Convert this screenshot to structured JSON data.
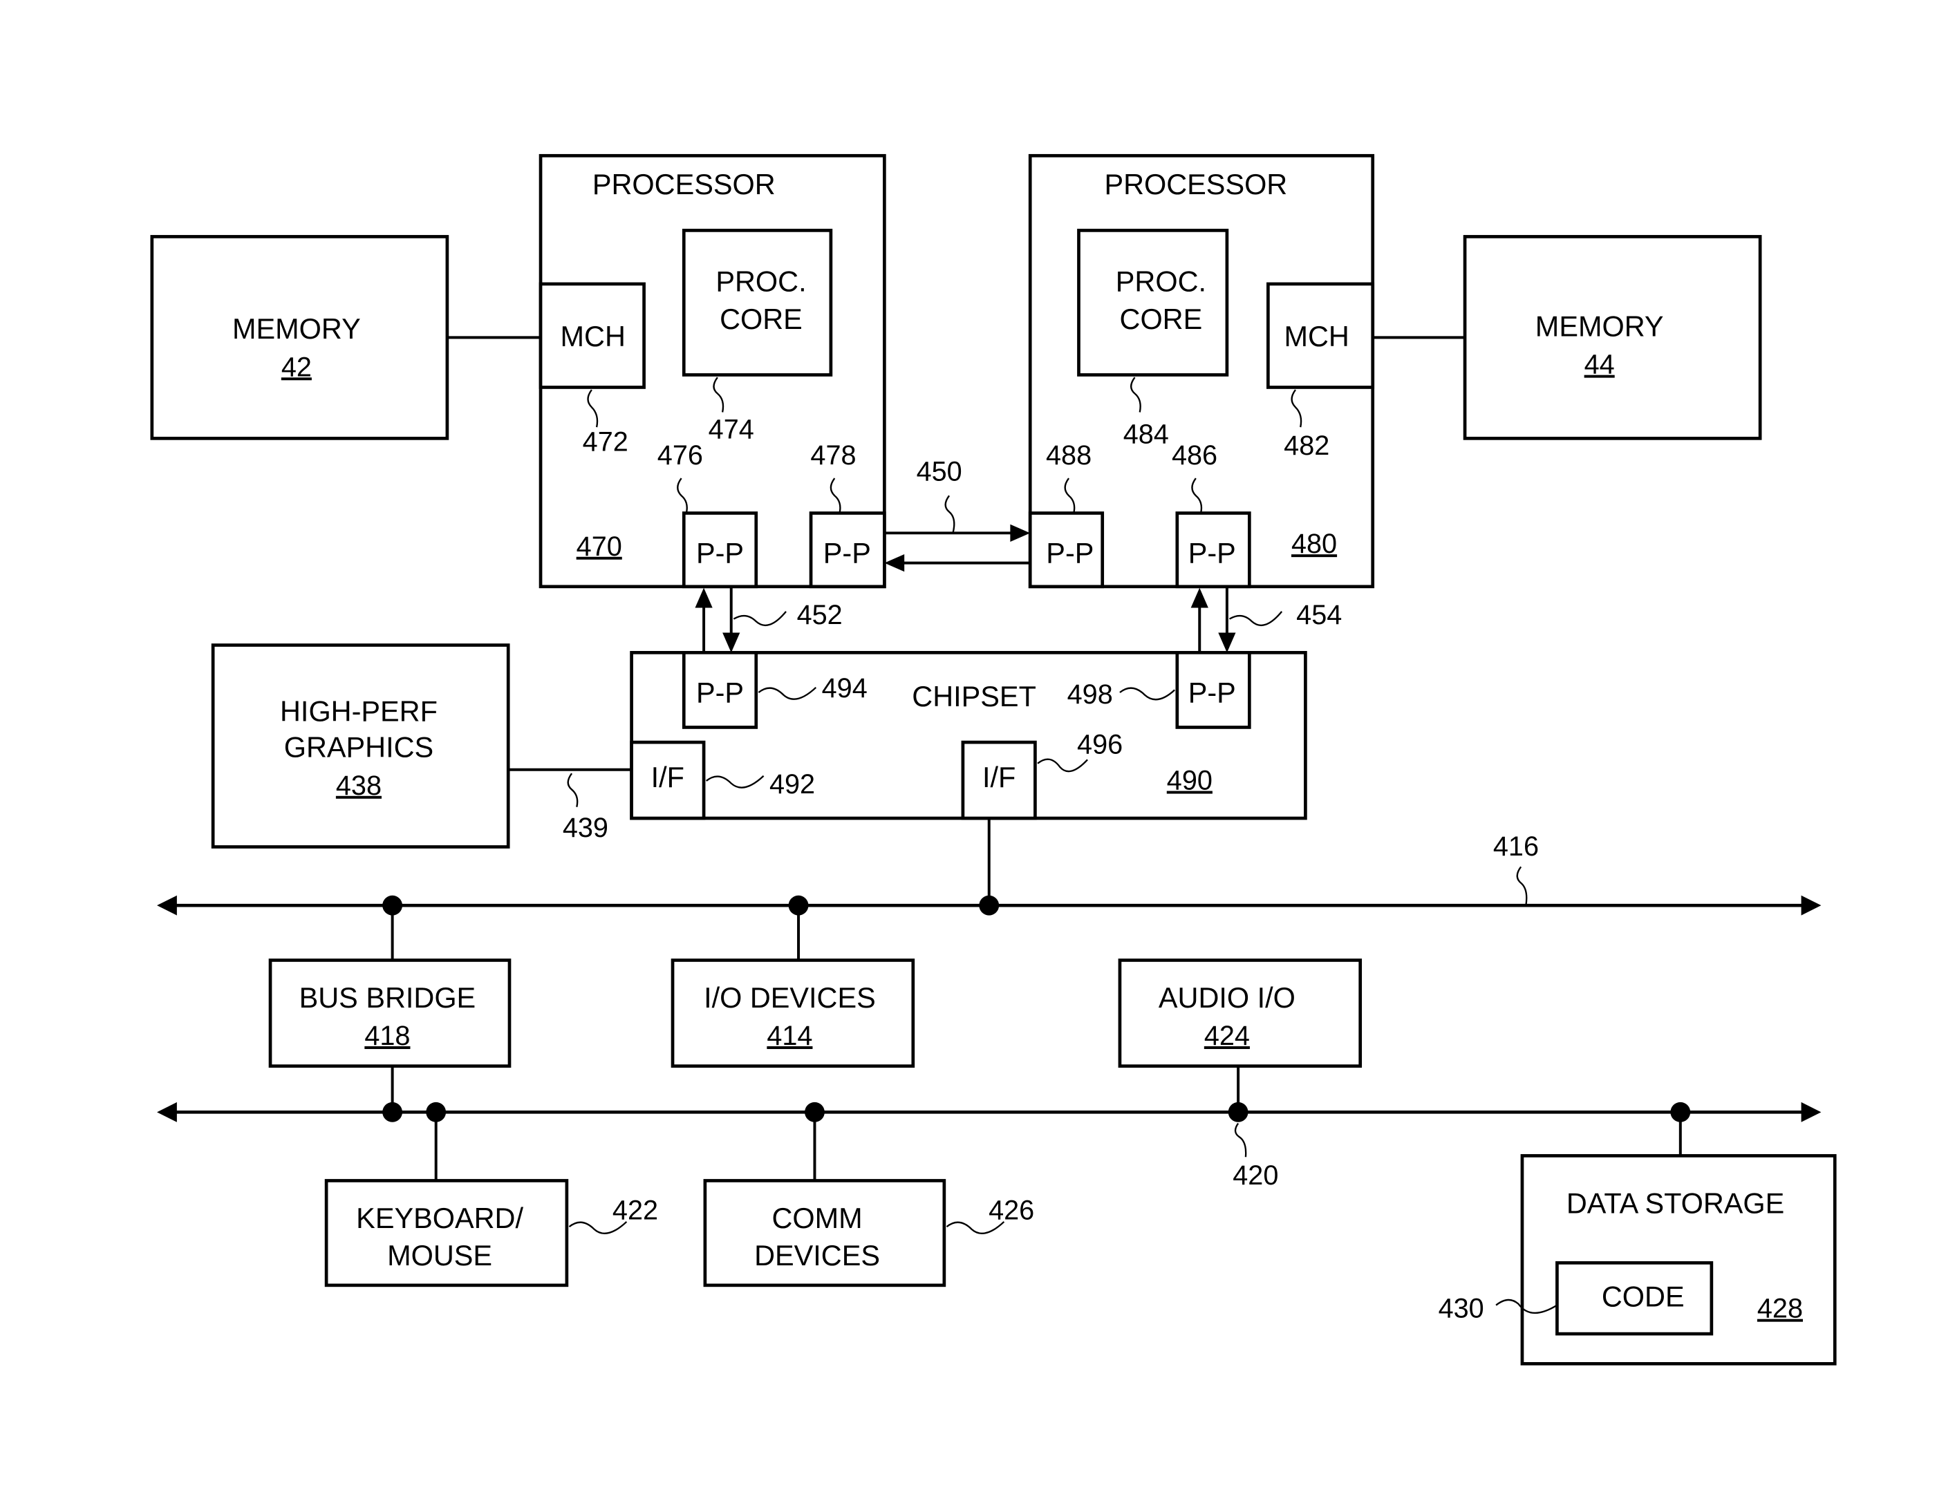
{
  "figure": {
    "type": "block-diagram",
    "subject": "multiprocessor computer system"
  },
  "processors": [
    {
      "id": "470",
      "title": "PROCESSOR",
      "ref_label": "470",
      "mch": {
        "label": "MCH",
        "ref": "472"
      },
      "core": {
        "line1": "PROC.",
        "line2": "CORE",
        "ref": "474"
      },
      "pp_chipset": {
        "label": "P-P",
        "ref": "476"
      },
      "pp_peer": {
        "label": "P-P",
        "ref": "478"
      }
    },
    {
      "id": "480",
      "title": "PROCESSOR",
      "ref_label": "480",
      "mch": {
        "label": "MCH",
        "ref": "482"
      },
      "core": {
        "line1": "PROC.",
        "line2": "CORE",
        "ref": "484"
      },
      "pp_chipset": {
        "label": "P-P",
        "ref": "486"
      },
      "pp_peer": {
        "label": "P-P",
        "ref": "488"
      }
    }
  ],
  "memories": [
    {
      "label": "MEMORY",
      "ref": "42"
    },
    {
      "label": "MEMORY",
      "ref": "44"
    }
  ],
  "links": {
    "processor_interconnect": "450",
    "proc0_chipset": "452",
    "proc1_chipset": "454",
    "graphics_link": "439"
  },
  "chipset": {
    "label": "CHIPSET",
    "ref_label": "490",
    "pp_left": {
      "label": "P-P",
      "ref": "494"
    },
    "pp_right": {
      "label": "P-P",
      "ref": "498"
    },
    "if_graphics": {
      "label": "I/F",
      "ref": "492"
    },
    "if_bus": {
      "label": "I/F",
      "ref": "496"
    }
  },
  "graphics": {
    "line1": "HIGH-PERF",
    "line2": "GRAPHICS",
    "ref": "438"
  },
  "buses": {
    "first": {
      "ref": "416"
    },
    "second": {
      "ref": "420"
    }
  },
  "devices": {
    "bus_bridge": {
      "label": "BUS BRIDGE",
      "ref": "418"
    },
    "io_devices": {
      "label": "I/O DEVICES",
      "ref": "414"
    },
    "audio_io": {
      "label": "AUDIO I/O",
      "ref": "424"
    },
    "keyboard_mouse": {
      "line1": "KEYBOARD/",
      "line2": "MOUSE",
      "ref": "422"
    },
    "comm_devices": {
      "line1": "COMM",
      "line2": "DEVICES",
      "ref": "426"
    },
    "data_storage": {
      "label": "DATA STORAGE",
      "ref": "428",
      "code_label": "CODE",
      "code_ref": "430"
    }
  }
}
